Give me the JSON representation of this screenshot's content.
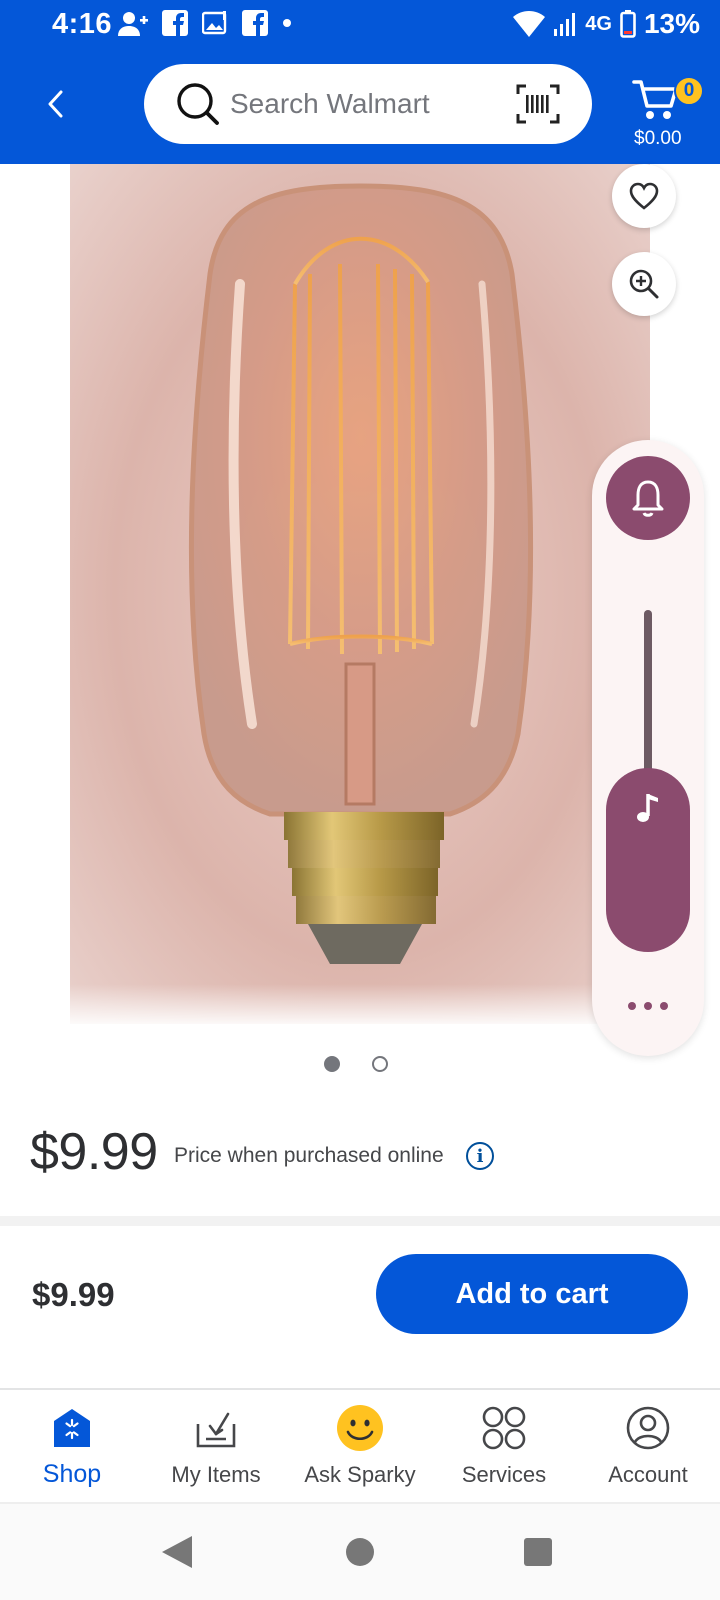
{
  "status_bar": {
    "time": "4:16",
    "network": "4G",
    "battery": "13%"
  },
  "header": {
    "search_placeholder": "Search Walmart",
    "cart_badge": "0",
    "cart_total": "$0.00"
  },
  "product": {
    "image_count": 2,
    "active_image": 1,
    "price": "$9.99",
    "price_note": "Price when purchased online",
    "info_symbol": "i"
  },
  "volume_overlay": {
    "level_percent": 0
  },
  "cart_bar": {
    "price": "$9.99",
    "add_to_cart_label": "Add to cart"
  },
  "bottom_nav": {
    "items": [
      {
        "label": "Shop",
        "icon": "shop-icon",
        "active": true
      },
      {
        "label": "My Items",
        "icon": "my-items-icon",
        "active": false
      },
      {
        "label": "Ask Sparky",
        "icon": "sparky-icon",
        "active": false
      },
      {
        "label": "Services",
        "icon": "services-icon",
        "active": false
      },
      {
        "label": "Account",
        "icon": "account-icon",
        "active": false
      }
    ]
  },
  "colors": {
    "brand_blue": "#0457d8",
    "spark_yellow": "#ffc220",
    "overlay_accent": "#8b4b6e"
  }
}
